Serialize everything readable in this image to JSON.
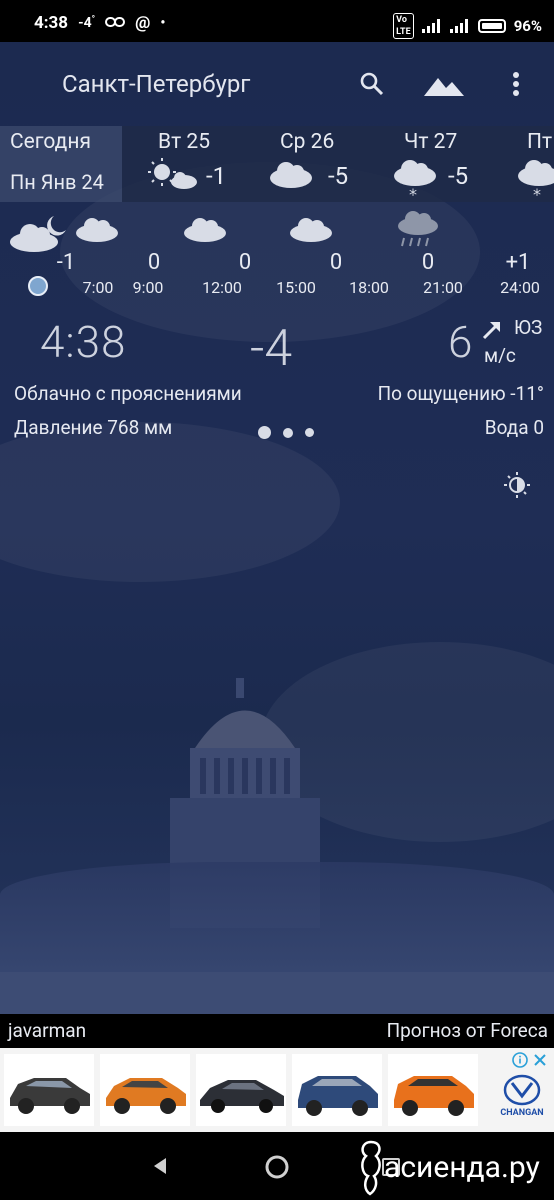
{
  "status": {
    "time": "4:38",
    "temp": "-4",
    "battery": "96%"
  },
  "appbar": {
    "city": "Санкт-Петербург"
  },
  "days": [
    {
      "name": "Сегодня",
      "date": "Пн Янв 24"
    },
    {
      "name": "Вт 25",
      "temp": "-1",
      "icon": "sun-cloud-icon"
    },
    {
      "name": "Ср 26",
      "temp": "-5",
      "icon": "cloud-icon"
    },
    {
      "name": "Чт 27",
      "temp": "-5",
      "icon": "cloud-snow-icon"
    },
    {
      "name": "Пт",
      "icon": "cloud-snow-icon"
    }
  ],
  "hourly": {
    "temps": [
      "-1",
      "0",
      "0",
      "0",
      "0",
      "+1"
    ],
    "times": [
      "7:00",
      "9:00",
      "12:00",
      "15:00",
      "18:00",
      "21:00",
      "24:00"
    ]
  },
  "current": {
    "time": "4:38",
    "temp": "-4",
    "wind_speed": "6",
    "wind_unit": "м/с",
    "wind_dir": "ЮЗ",
    "condition": "Облачно с прояснениями",
    "feels_like": "По ощущению -11°",
    "pressure": "Давление 768 мм",
    "water": "Вода 0"
  },
  "credits": {
    "user": "javarman",
    "provider": "Прогноз от Foreca"
  },
  "ad": {
    "brand": "CHANGAN"
  },
  "watermark": "асиенда.ру"
}
